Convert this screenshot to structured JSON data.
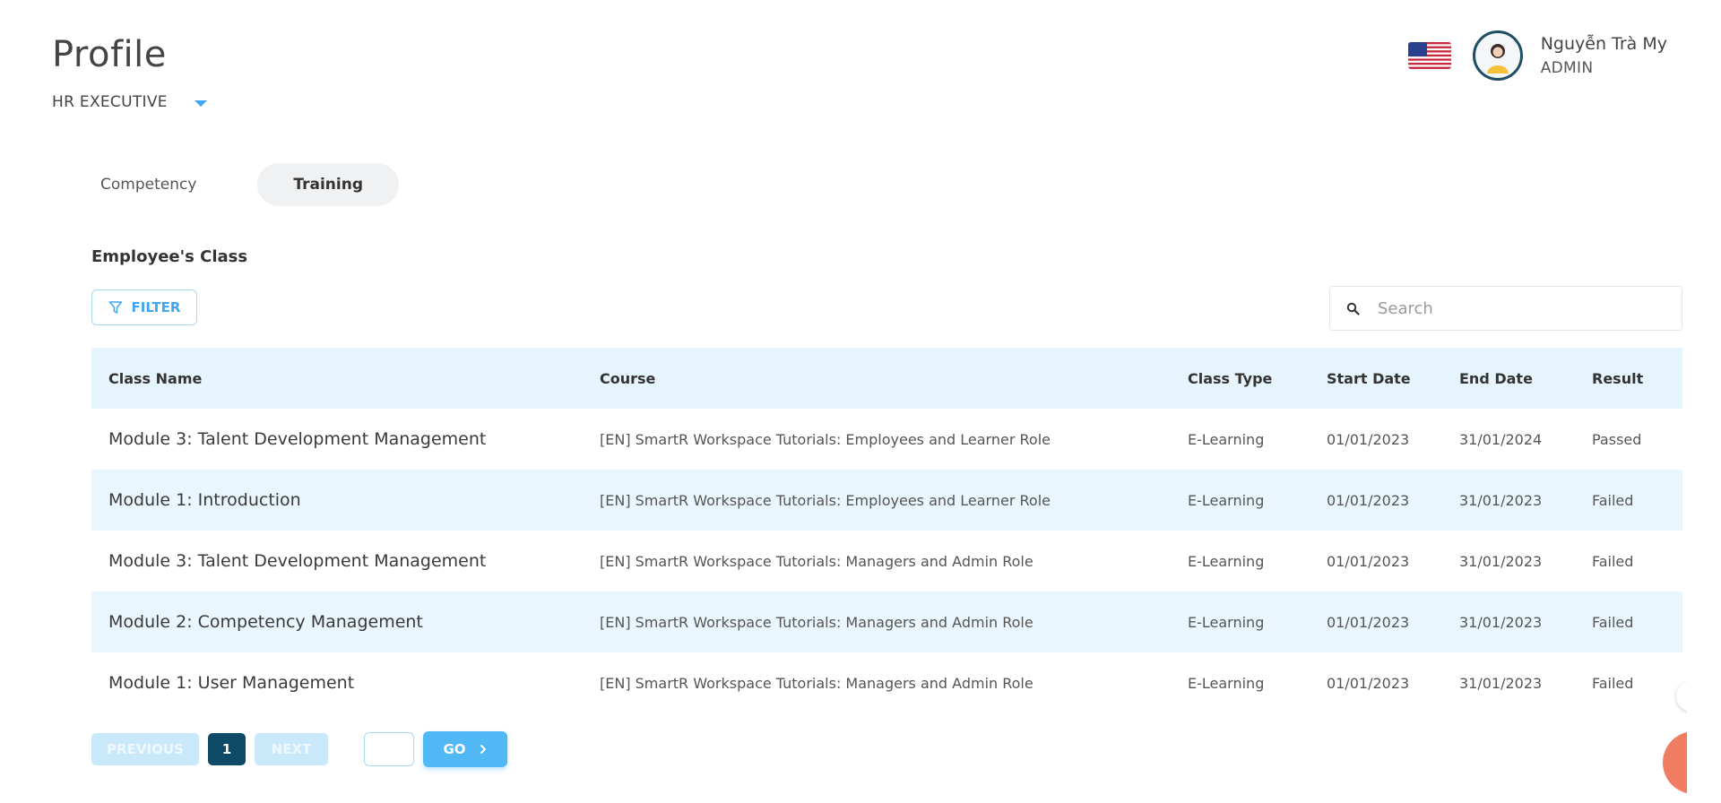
{
  "header": {
    "title": "Profile",
    "role_selector": "HR EXECUTIVE",
    "language_flag": "us-flag-icon",
    "user": {
      "name": "Nguyễn Trà My",
      "role": "ADMIN"
    }
  },
  "tabs": [
    {
      "label": "Competency",
      "active": false
    },
    {
      "label": "Training",
      "active": true
    }
  ],
  "section_title": "Employee's Class",
  "toolbar": {
    "filter_label": "FILTER",
    "search_placeholder": "Search"
  },
  "table": {
    "columns": [
      "Class Name",
      "Course",
      "Class Type",
      "Start Date",
      "End Date",
      "Result"
    ],
    "rows": [
      [
        "Module 3: Talent Development Management",
        "[EN] SmartR Workspace Tutorials: Employees and Learner Role",
        "E-Learning",
        "01/01/2023",
        "31/01/2024",
        "Passed"
      ],
      [
        "Module 1: Introduction",
        "[EN] SmartR Workspace Tutorials: Employees and Learner Role",
        "E-Learning",
        "01/01/2023",
        "31/01/2023",
        "Failed"
      ],
      [
        "Module 3: Talent Development Management",
        "[EN] SmartR Workspace Tutorials: Managers and Admin Role",
        "E-Learning",
        "01/01/2023",
        "31/01/2023",
        "Failed"
      ],
      [
        "Module 2: Competency Management",
        "[EN] SmartR Workspace Tutorials: Managers and Admin Role",
        "E-Learning",
        "01/01/2023",
        "31/01/2023",
        "Failed"
      ],
      [
        "Module 1: User Management",
        "[EN] SmartR Workspace Tutorials: Managers and Admin Role",
        "E-Learning",
        "01/01/2023",
        "31/01/2023",
        "Failed"
      ]
    ]
  },
  "pagination": {
    "previous_label": "PREVIOUS",
    "current_page": "1",
    "next_label": "NEXT",
    "go_label": "GO",
    "page_input_value": ""
  },
  "colors": {
    "accent": "#3fa7f0",
    "header_row_bg": "#e6f5fd",
    "current_page_bg": "#0e4a66",
    "chat_fab": "#f07d62"
  }
}
